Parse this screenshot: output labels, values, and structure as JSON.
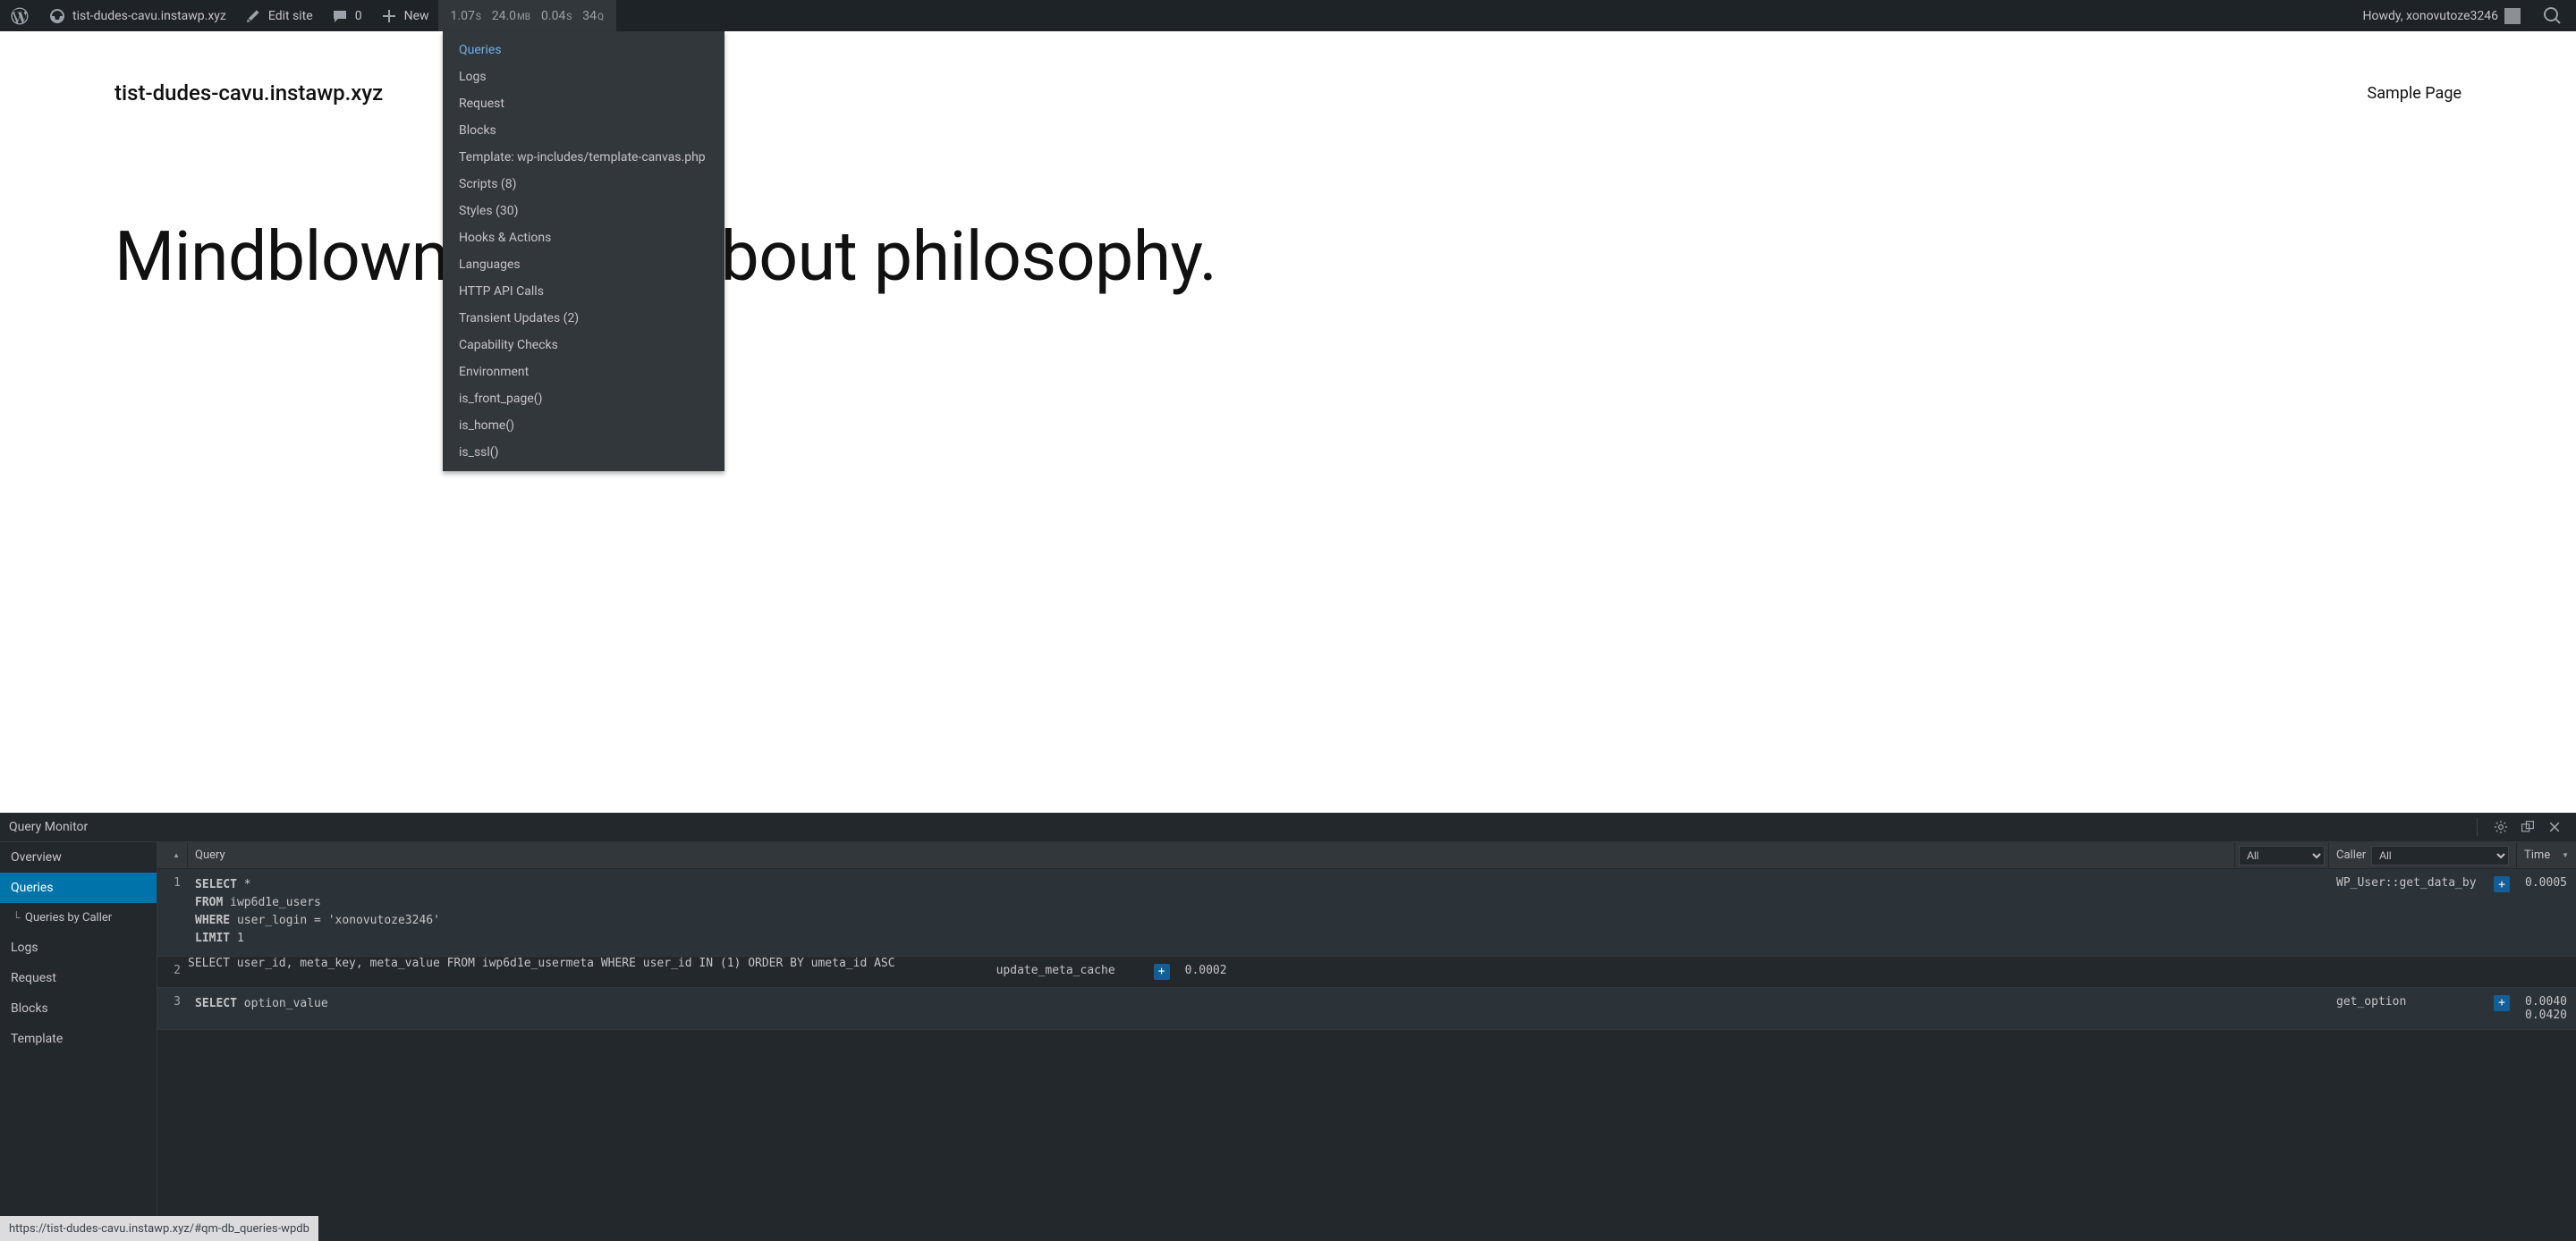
{
  "adminbar": {
    "site_name": "tist-dudes-cavu.instawp.xyz",
    "edit_site": "Edit site",
    "comments": "0",
    "new": "New",
    "stats": {
      "time1": "1.07",
      "time1s": "S",
      "mem": "24.0",
      "mems": "MB",
      "time2": "0.04",
      "time2s": "S",
      "q": "34",
      "qs": "Q"
    },
    "howdy": "Howdy, xonovutoze3246"
  },
  "dropdown": {
    "items": [
      "Queries",
      "Logs",
      "Request",
      "Blocks",
      "Template: wp-includes/template-canvas.php",
      "Scripts (8)",
      "Styles (30)",
      "Hooks & Actions",
      "Languages",
      "HTTP API Calls",
      "Transient Updates (2)",
      "Capability Checks",
      "Environment",
      "is_front_page()",
      "is_home()",
      "is_ssl()"
    ]
  },
  "page": {
    "site_title": "tist-dudes-cavu.instawp.xyz",
    "menu_link": "Sample Page",
    "hero": "Mindblown: a blog about philosophy."
  },
  "qm": {
    "title": "Query Monitor",
    "sidebar": [
      "Overview",
      "Queries",
      "Queries by Caller",
      "Logs",
      "Request",
      "Blocks",
      "Template"
    ],
    "thead": {
      "num_sort": "▲",
      "query": "Query",
      "all1": "All",
      "caller": "Caller",
      "all2": "All",
      "time": "Time",
      "time_sort": "▼"
    },
    "rows": [
      {
        "n": "1",
        "sql": "SELECT *\nFROM iwp6d1e_users\nWHERE user_login = 'xonovutoze3246'\nLIMIT 1",
        "caller": "WP_User::get_data_by",
        "time": "0.0005"
      },
      {
        "n": "2",
        "sql": "SELECT user_id, meta_key, meta_value\nFROM iwp6d1e_usermeta\nWHERE user_id IN (1)\nORDER BY umeta_id ASC",
        "caller": "update_meta_cache",
        "time": "0.0002"
      },
      {
        "n": "3",
        "sql": "SELECT option_value",
        "caller": "get_option",
        "time": "0.0040"
      }
    ],
    "extra_time": "0.0420"
  },
  "status_url": "https://tist-dudes-cavu.instawp.xyz/#qm-db_queries-wpdb"
}
